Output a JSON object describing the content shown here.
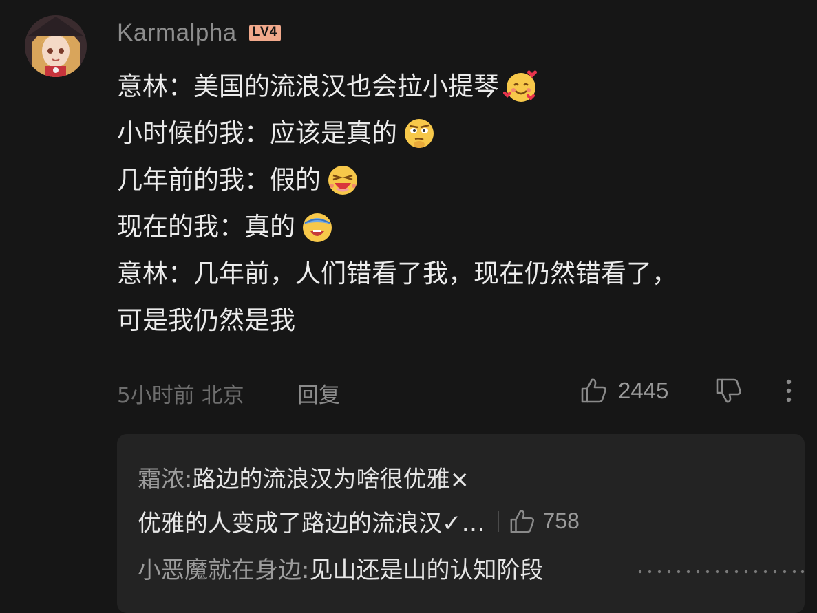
{
  "comment": {
    "username": "Karmalpha",
    "level": "LV4",
    "lines": [
      "意林：美国的流浪汉也会拉小提琴",
      "小时候的我：应该是真的",
      "几年前的我：假的",
      "现在的我：真的",
      "意林：几年前，人们错看了我，现在仍然错看了，",
      "可是我仍然是我"
    ],
    "emojis": [
      "smiling-face-with-hearts",
      "skeptical-face",
      "laughing-face",
      "covering-eyes-face"
    ],
    "time_location": "5小时前 北京",
    "reply_label": "回复",
    "like_count": "2445"
  },
  "replies": {
    "items": [
      {
        "author": "霜浓:",
        "text": "路边的流浪汉为啥很优雅×"
      },
      {
        "author": "",
        "text": "优雅的人变成了路边的流浪汉✓…",
        "like_count": "758"
      },
      {
        "author": "小恶魔就在身边:",
        "text": "见山还是山的认知阶段"
      }
    ]
  },
  "colors": {
    "background": "#161616",
    "reply_box": "#232323",
    "level_badge": "#f1a98c",
    "text": "#ececec",
    "muted": "#6e6e6e"
  }
}
